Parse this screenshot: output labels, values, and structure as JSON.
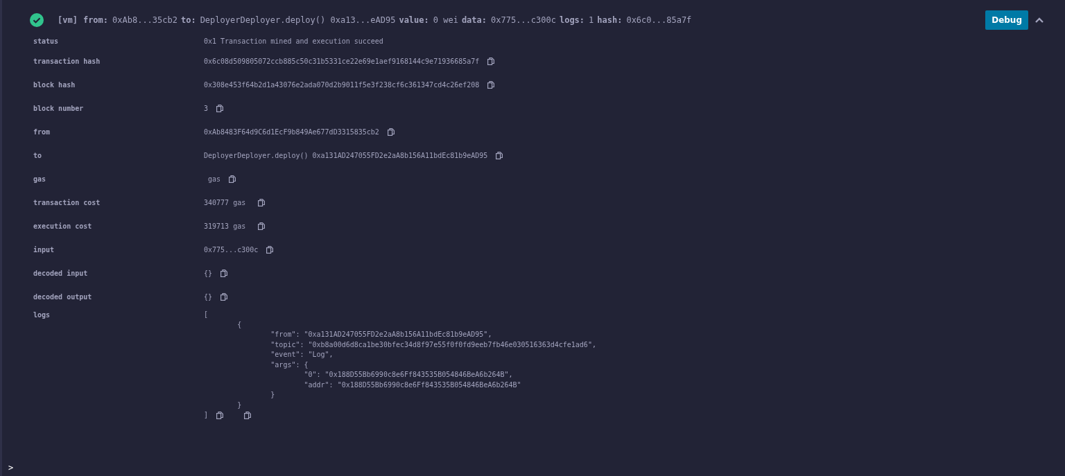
{
  "header": {
    "succeeded": true,
    "tag": "[vm]",
    "fields": [
      {
        "label": "from:",
        "value": "0xAb8...35cb2"
      },
      {
        "label": "to:",
        "value": "DeployerDeployer.deploy() 0xa13...eAD95"
      },
      {
        "label": "value:",
        "value": "0 wei"
      },
      {
        "label": "data:",
        "value": "0x775...c300c"
      },
      {
        "label": "logs:",
        "value": "1"
      },
      {
        "label": "hash:",
        "value": "0x6c0...85a7f"
      }
    ],
    "debug_button": "Debug",
    "expanded": true
  },
  "rows": [
    {
      "kind": "plain",
      "label": "status",
      "value": "0x1 Transaction mined and execution succeed"
    },
    {
      "kind": "copy",
      "label": "transaction hash",
      "value": "0x6c08d509805072ccb885c50c31b5331ce22e69e1aef9168144c9e71936685a7f"
    },
    {
      "kind": "copy",
      "label": "block hash",
      "value": "0x308e453f64b2d1a43076e2ada070d2b9011f5e3f238cf6c361347cd4c26ef208"
    },
    {
      "kind": "copy",
      "label": "block number",
      "value": "3"
    },
    {
      "kind": "copy",
      "label": "from",
      "value": "0xAb8483F64d9C6d1EcF9b849Ae677dD3315835cb2"
    },
    {
      "kind": "copy",
      "label": "to",
      "value": "DeployerDeployer.deploy() 0xa131AD247055FD2e2aA8b156A11bdEc81b9eAD95"
    },
    {
      "kind": "copy",
      "label": "gas",
      "value": " gas"
    },
    {
      "kind": "copy",
      "label": "transaction cost",
      "value": "340777 gas "
    },
    {
      "kind": "copy",
      "label": "execution cost",
      "value": "319713 gas "
    },
    {
      "kind": "copy",
      "label": "input",
      "value": "0x775...c300c"
    },
    {
      "kind": "copy",
      "label": "decoded input",
      "value": "{}"
    },
    {
      "kind": "copy",
      "label": "decoded output",
      "value": "{}"
    },
    {
      "kind": "log",
      "label": "logs",
      "lines": [
        "[",
        "\t{",
        "\t\t\"from\": \"0xa131AD247055FD2e2aA8b156A11bdEc81b9eAD95\",",
        "\t\t\"topic\": \"0xb8a00d6d8ca1be30bfec34d8f97e55f0f0fd9eeb7fb46e030516363d4cfe1ad6\",",
        "\t\t\"event\": \"Log\",",
        "\t\t\"args\": {",
        "\t\t\t\"0\": \"0x188D55Bb6990c8e6Ff843535B054846BeA6b264B\",",
        "\t\t\t\"addr\": \"0x188D55Bb6990c8e6Ff843535B054846BeA6b264B\"",
        "\t\t}",
        "\t}",
        "]"
      ]
    }
  ],
  "prompt": ">"
}
